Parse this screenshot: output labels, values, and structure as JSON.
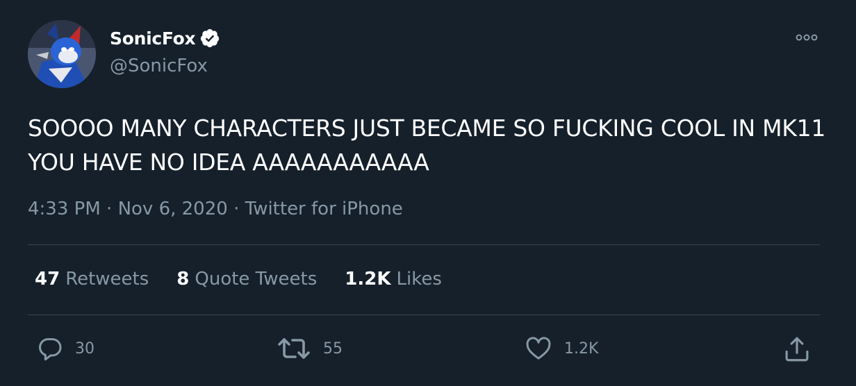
{
  "user": {
    "display_name": "SonicFox",
    "handle": "@SonicFox"
  },
  "tweet": {
    "text": "SOOOO MANY CHARACTERS JUST BECAME SO FUCKING COOL IN MK11 YOU HAVE NO IDEA AAAAAAAAAAA",
    "time": "4:33 PM",
    "date": "Nov 6, 2020",
    "separator": "·",
    "source": "Twitter for iPhone"
  },
  "stats": {
    "retweets_count": "47",
    "retweets_label": "Retweets",
    "quotes_count": "8",
    "quotes_label": "Quote Tweets",
    "likes_count": "1.2K",
    "likes_label": "Likes"
  },
  "actions": {
    "reply_count": "30",
    "retweet_count": "55",
    "like_count": "1.2K"
  },
  "icons": {
    "verified": "verified-badge-icon",
    "more": "more-options-icon",
    "reply": "reply-icon",
    "retweet": "retweet-icon",
    "like": "heart-icon",
    "share": "share-icon"
  },
  "colors": {
    "background": "#15202b",
    "text": "#ffffff",
    "secondary": "#8899a6",
    "divider": "#38444d"
  }
}
